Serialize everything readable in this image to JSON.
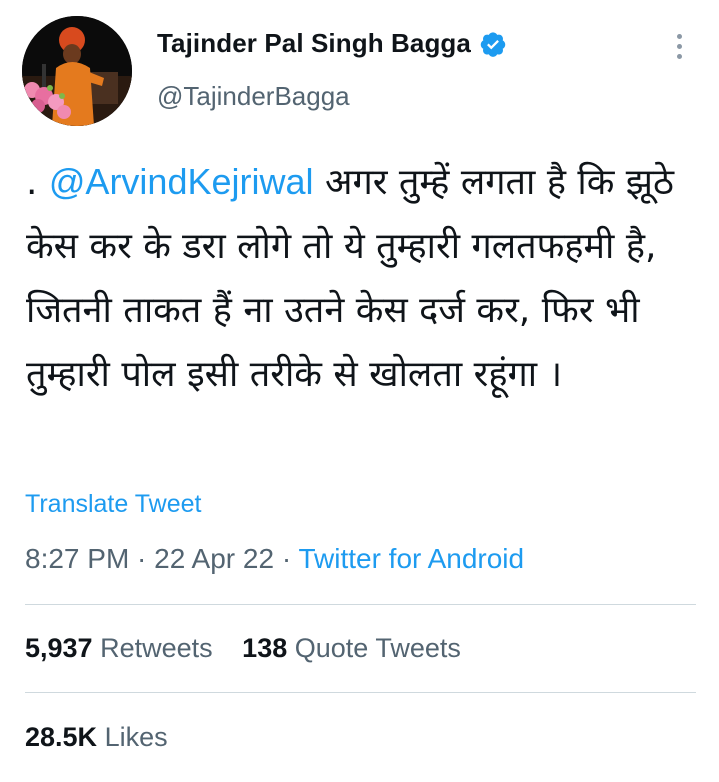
{
  "author": {
    "display_name": "Tajinder Pal Singh Bagga",
    "handle": "@TajinderBagga"
  },
  "tweet": {
    "prefix": ". ",
    "mention": "@ArvindKejriwal",
    "body": " अगर तुम्हें लगता है कि झूठे केस कर के डरा लोगे तो ये तुम्हारी गलतफहमी है, जितनी ताकत हैं ना उतने केस दर्ज कर, फिर भी तुम्हारी पोल इसी तरीके से खोलता रहूंगा ।",
    "translate_label": "Translate Tweet"
  },
  "meta": {
    "time": "8:27 PM",
    "separator1": " · ",
    "date": "22 Apr 22",
    "separator2": " · ",
    "source": "Twitter for Android"
  },
  "stats": {
    "retweets_count": "5,937",
    "retweets_label": "Retweets",
    "quotes_count": "138",
    "quotes_label": "Quote Tweets",
    "likes_count": "28.5K",
    "likes_label": "Likes"
  },
  "icons": {
    "verified": "verified-badge-icon",
    "more": "more-vertical-icon"
  },
  "colors": {
    "accent": "#1d9bf0",
    "text": "#0f1419",
    "muted": "#536471",
    "divider": "#cfd9de"
  }
}
